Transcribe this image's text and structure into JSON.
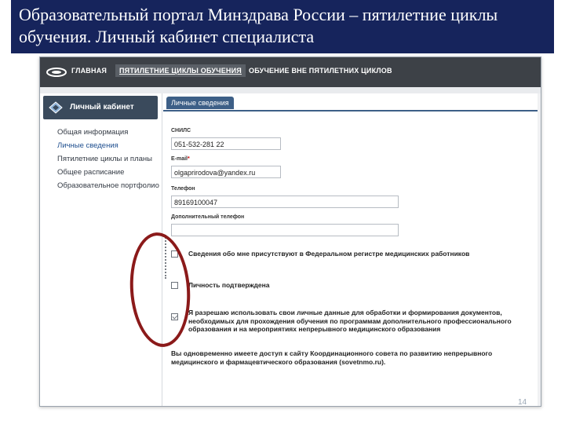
{
  "slide": {
    "title": "Образовательный портал Минздрава России – пятилетние циклы обучения. Личный кабинет специалиста",
    "page_number": "14"
  },
  "colors": {
    "title_bg": "#16245c",
    "nav_bg": "#3d4147",
    "tab_bg": "#3d5f87",
    "highlight_oval": "#8b1a1a"
  },
  "topnav": {
    "logo_icon": "portal-logo-icon",
    "items": [
      "ГЛАВНАЯ",
      "ПЯТИЛЕТНИЕ ЦИКЛЫ ОБУЧЕНИЯ",
      "ОБУЧЕНИЕ ВНЕ ПЯТИЛЕТНИХ ЦИКЛОВ"
    ]
  },
  "sidebar": {
    "header": "Личный кабинет",
    "header_icon": "cabinet-icon",
    "items": [
      "Общая информация",
      "Личные сведения",
      "Пятилетние циклы и планы",
      "Общее расписание",
      "Образовательное портфолио"
    ]
  },
  "content": {
    "tab_label": "Личные сведения",
    "fields": {
      "snils": {
        "label": "СНИЛС",
        "value": "051-532-281 22"
      },
      "email": {
        "label": "E-mail",
        "required_mark": "*",
        "value": "olgaprirodova@yandex.ru"
      },
      "phone": {
        "label": "Телефон",
        "value": "89169100047"
      },
      "extra_phone": {
        "label": "Дополнительный телефон",
        "value": ""
      }
    },
    "checkboxes": [
      {
        "label": "Сведения обо мне присутствуют в Федеральном регистре медицинских работников"
      },
      {
        "label": "Личность подтверждена"
      },
      {
        "label": "Я разрешаю использовать свои личные данные для обработки и формирования документов, необходимых для прохождения обучения по программам дополнительного профессионального образования и на мероприятиях непрерывного медицинского образования"
      }
    ],
    "note": "Вы одновременно имеете доступ к сайту Координационного совета по развитию непрерывного медицинского и фармацевтического образования (sovetnmo.ru)."
  }
}
